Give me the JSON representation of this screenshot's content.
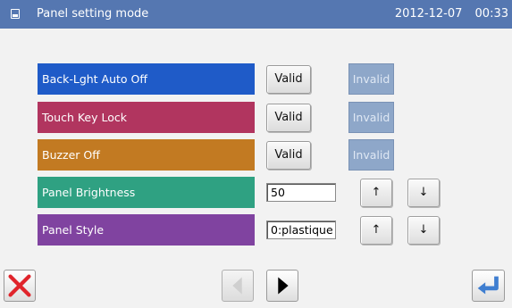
{
  "titlebar": {
    "icon": "panel-icon",
    "title": "Panel setting mode",
    "date": "2012-12-07",
    "time": "00:33"
  },
  "settings": [
    {
      "label": "Back-Lght Auto Off",
      "color": "#1f5bc8",
      "valid_label": "Valid",
      "invalid_label": "Invalid"
    },
    {
      "label": "Touch Key Lock",
      "color": "#b1355f",
      "valid_label": "Valid",
      "invalid_label": "Invalid"
    },
    {
      "label": "Buzzer Off",
      "color": "#c27a22",
      "valid_label": "Valid",
      "invalid_label": "Invalid"
    },
    {
      "label": "Panel Brightness",
      "color": "#2fa182",
      "value": "50",
      "up_label": "↑",
      "down_label": "↓"
    },
    {
      "label": "Panel Style",
      "color": "#8043a0",
      "value": "0:plastique",
      "up_label": "↑",
      "down_label": "↓"
    }
  ],
  "footer": {
    "cancel_icon": "close-icon",
    "prev_icon": "triangle-left-icon",
    "next_icon": "triangle-right-icon",
    "enter_icon": "enter-arrow-icon"
  },
  "colors": {
    "titlebar": "#5577b1",
    "invalid_button": "#8ea7c9",
    "cancel_red": "#e0242b",
    "enter_blue": "#3f7ed0"
  }
}
